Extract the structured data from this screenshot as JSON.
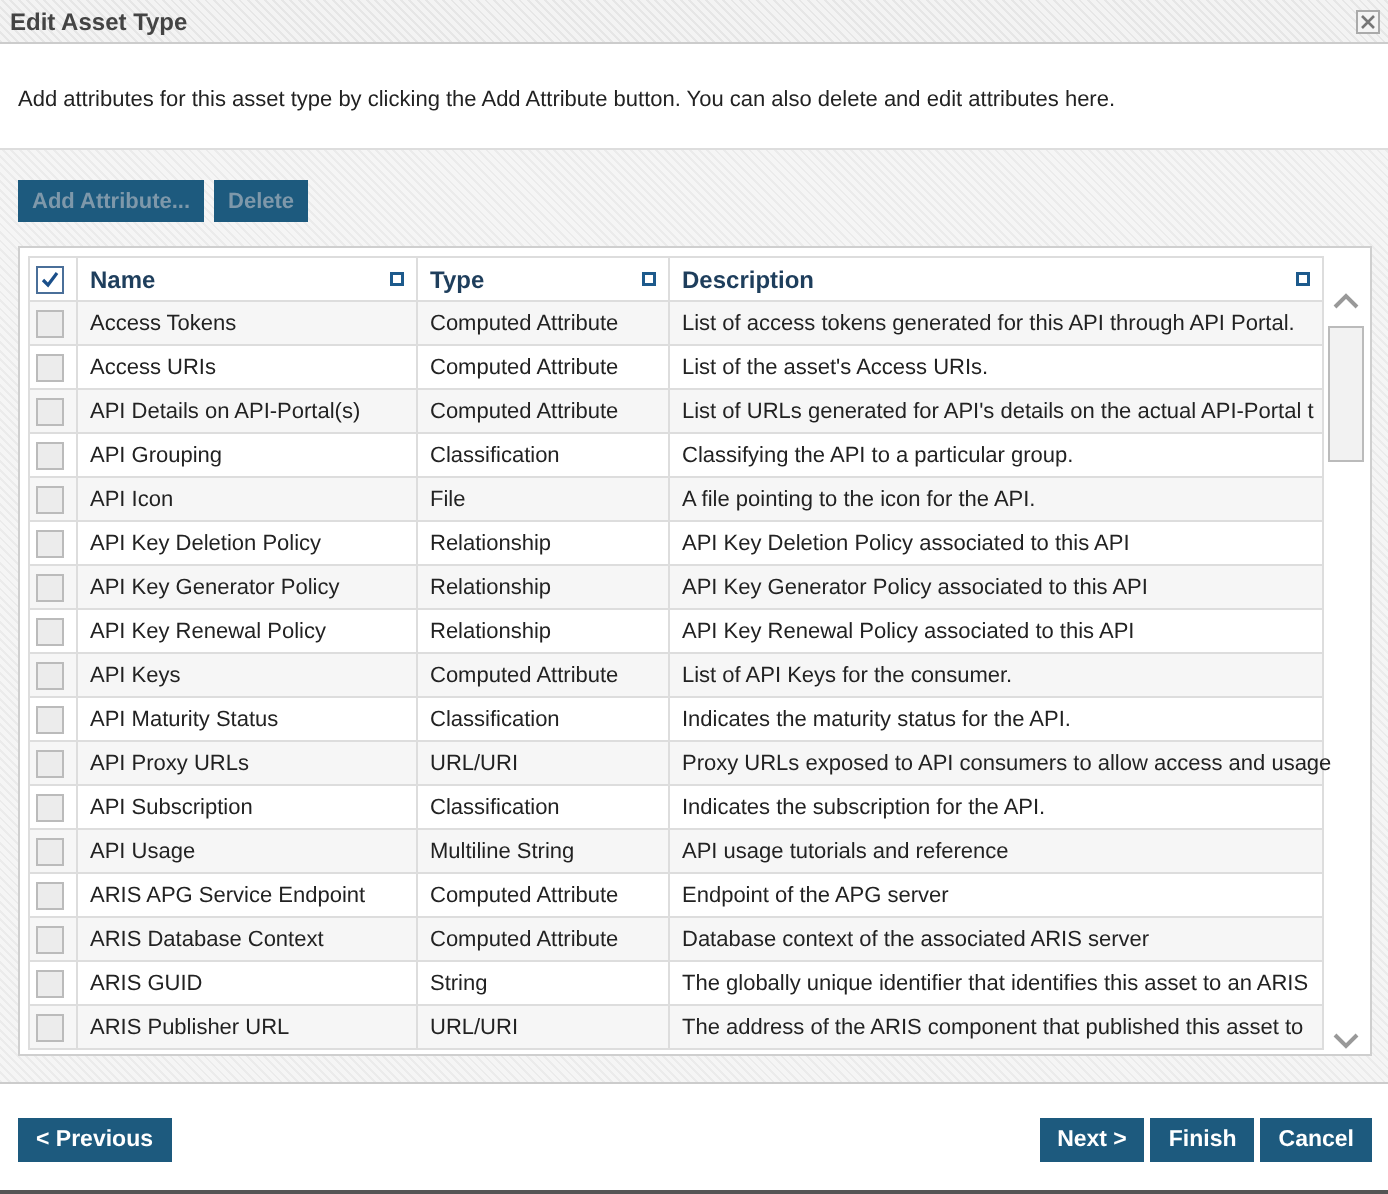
{
  "window": {
    "title": "Edit Asset Type"
  },
  "intro": "Add attributes for this asset type by clicking the Add Attribute button. You can also delete and edit attributes here.",
  "toolbar": [
    {
      "label": "Add Attribute...",
      "disabled": true
    },
    {
      "label": "Delete",
      "disabled": true
    }
  ],
  "table": {
    "select_all": {
      "checked": true
    },
    "columns": [
      "Name",
      "Type",
      "Description"
    ],
    "rows": [
      {
        "name": "Access Tokens",
        "type": "Computed Attribute",
        "description": "List of access tokens generated for this API through API Portal.",
        "checked": false
      },
      {
        "name": "Access URIs",
        "type": "Computed Attribute",
        "description": "List of the asset's Access URIs.",
        "checked": false
      },
      {
        "name": "API Details on API-Portal(s)",
        "type": "Computed Attribute",
        "description": "List of URLs generated for API's details on the actual API-Portal t",
        "checked": false
      },
      {
        "name": "API Grouping",
        "type": "Classification",
        "description": "Classifying the API to a particular group.",
        "checked": false
      },
      {
        "name": "API Icon",
        "type": "File",
        "description": "A file pointing to the icon for the API.",
        "checked": false
      },
      {
        "name": "API Key Deletion Policy",
        "type": "Relationship",
        "description": "API Key Deletion Policy associated to this API",
        "checked": false
      },
      {
        "name": "API Key Generator Policy",
        "type": "Relationship",
        "description": "API Key Generator Policy associated to this API",
        "checked": false
      },
      {
        "name": "API Key Renewal Policy",
        "type": "Relationship",
        "description": "API Key Renewal Policy associated to this API",
        "checked": false
      },
      {
        "name": "API Keys",
        "type": "Computed Attribute",
        "description": "List of API Keys for the consumer.",
        "checked": false
      },
      {
        "name": "API Maturity Status",
        "type": "Classification",
        "description": "Indicates the maturity status for the API.",
        "checked": false
      },
      {
        "name": "API Proxy URLs",
        "type": "URL/URI",
        "description": "Proxy URLs exposed to API consumers to allow access and usage",
        "checked": false
      },
      {
        "name": "API Subscription",
        "type": "Classification",
        "description": "Indicates the subscription for the API.",
        "checked": false
      },
      {
        "name": "API Usage",
        "type": "Multiline String",
        "description": "API usage tutorials and reference",
        "checked": false
      },
      {
        "name": "ARIS APG Service Endpoint",
        "type": "Computed Attribute",
        "description": "Endpoint of the APG server",
        "checked": false
      },
      {
        "name": "ARIS Database Context",
        "type": "Computed Attribute",
        "description": "Database context of the associated ARIS server",
        "checked": false
      },
      {
        "name": "ARIS GUID",
        "type": "String",
        "description": "The globally unique identifier that identifies this asset to an ARIS",
        "checked": false
      },
      {
        "name": "ARIS Publisher URL",
        "type": "URL/URI",
        "description": "The address of the ARIS component that published this asset to",
        "checked": false
      }
    ]
  },
  "footer": {
    "left": [
      "< Previous"
    ],
    "right": [
      "Next >",
      "Finish",
      "Cancel"
    ]
  }
}
